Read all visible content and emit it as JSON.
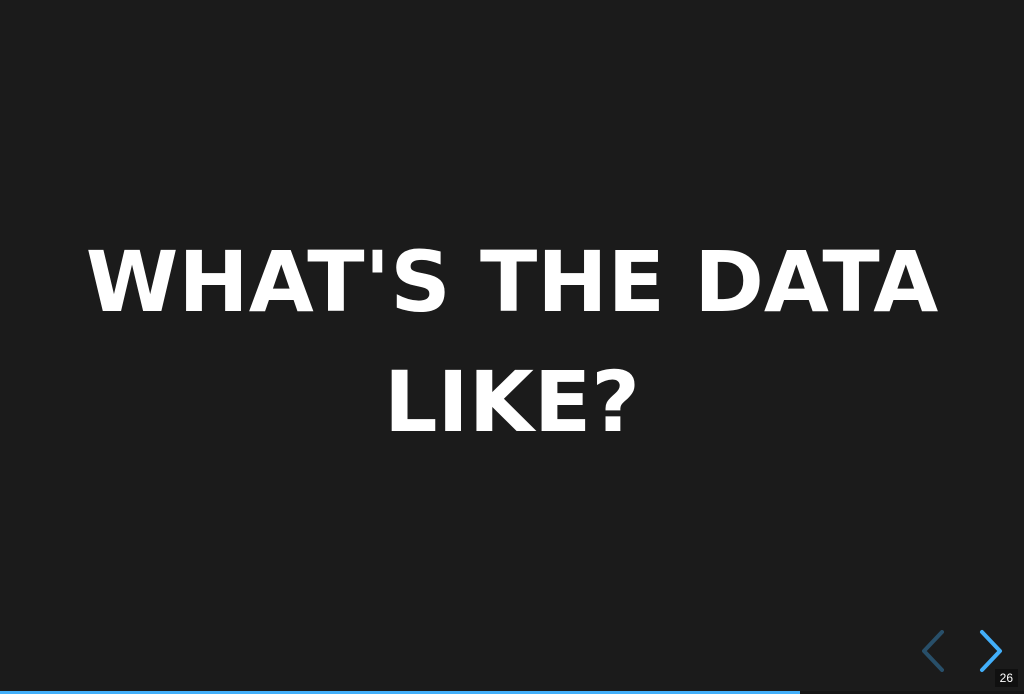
{
  "slide": {
    "title_lines": [
      "WHAT'S THE DATA",
      "LIKE?"
    ],
    "number": "26"
  },
  "progress": {
    "fraction": 0.781
  },
  "controls": {
    "prev_icon": "chevron-left-icon",
    "next_icon": "chevron-right-icon"
  },
  "colors": {
    "background": "#1b1b1b",
    "text": "#ffffff",
    "accent": "#42affa"
  }
}
